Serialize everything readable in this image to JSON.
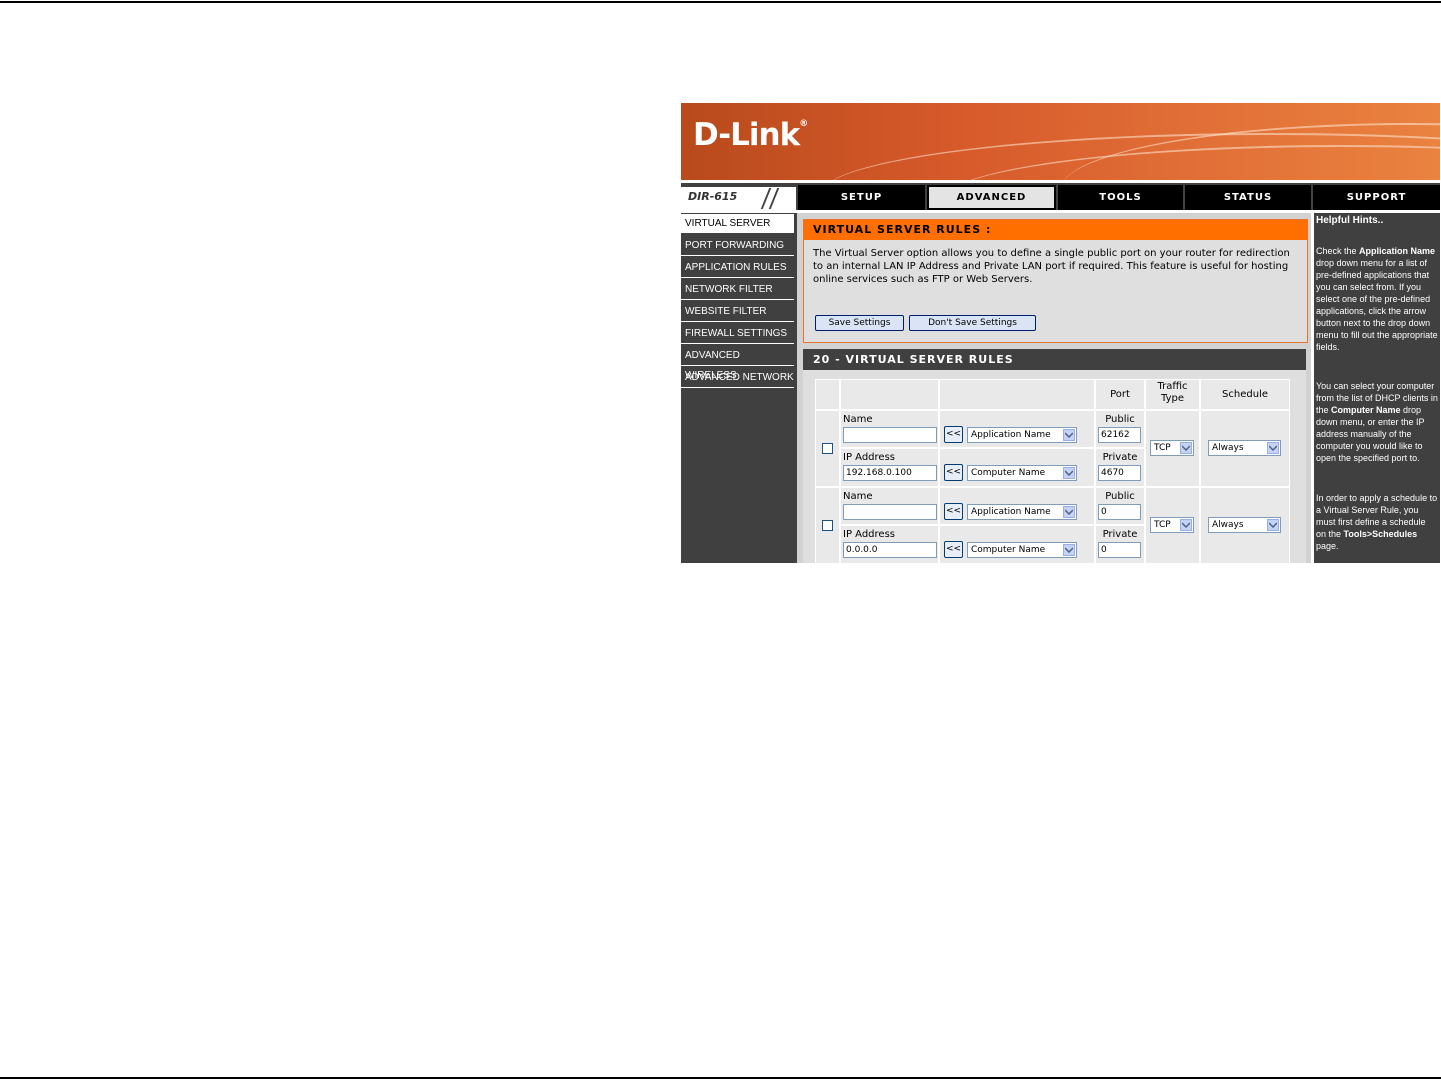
{
  "brand": {
    "logo": "D-Link",
    "registered": "®",
    "model": "DIR-615"
  },
  "tabs": [
    {
      "label": "SETUP"
    },
    {
      "label": "ADVANCED",
      "active": true
    },
    {
      "label": "TOOLS"
    },
    {
      "label": "STATUS"
    },
    {
      "label": "SUPPORT"
    }
  ],
  "sidebar": {
    "items": [
      {
        "label": "VIRTUAL SERVER",
        "active": true
      },
      {
        "label": "PORT FORWARDING"
      },
      {
        "label": "APPLICATION RULES"
      },
      {
        "label": "NETWORK FILTER"
      },
      {
        "label": "WEBSITE FILTER"
      },
      {
        "label": "FIREWALL SETTINGS"
      },
      {
        "label": "ADVANCED WIRELESS"
      },
      {
        "label": "ADVANCED NETWORK"
      }
    ]
  },
  "intro": {
    "title": "VIRTUAL SERVER RULES :",
    "description": "The Virtual Server option allows you to define a single public port on your router for redirection to an internal LAN IP Address and Private LAN port if required. This feature is useful for hosting online services such as FTP or Web Servers.",
    "save_label": "Save Settings",
    "dont_save_label": "Don't Save Settings"
  },
  "rules": {
    "title": "20 - VIRTUAL SERVER RULES",
    "headers": {
      "port": "Port",
      "traffic": "Traffic Type",
      "schedule": "Schedule"
    },
    "labels": {
      "name": "Name",
      "ip": "IP Address",
      "public": "Public",
      "private": "Private",
      "copy_button": "<<"
    },
    "rows": [
      {
        "checked": false,
        "name": "",
        "ip": "192.168.0.100",
        "application": "Application Name",
        "computer": "Computer Name",
        "public_port": "62162",
        "private_port": "4670",
        "traffic": "TCP",
        "schedule": "Always"
      },
      {
        "checked": false,
        "name": "",
        "ip": "0.0.0.0",
        "application": "Application Name",
        "computer": "Computer Name",
        "public_port": "0",
        "private_port": "0",
        "traffic": "TCP",
        "schedule": "Always"
      }
    ]
  },
  "hints": {
    "title": "Helpful Hints..",
    "p1_a": "Check the ",
    "p1_b": "Application Name",
    "p1_c": " drop down menu for a list of pre-defined applications that you can select from. If you select one of the pre-defined applications, click the arrow button next to the drop down menu to fill out the appropriate fields.",
    "p2_a": "You can select your computer from the list of DHCP clients in the ",
    "p2_b": "Computer Name",
    "p2_c": " drop down menu, or enter the IP address manually of the computer you would like to open the specified port to.",
    "p3_a": "In order to apply a schedule to a Virtual Server Rule, you must first define a schedule on the ",
    "p3_b": "Tools>Schedules",
    "p3_c": " page."
  }
}
